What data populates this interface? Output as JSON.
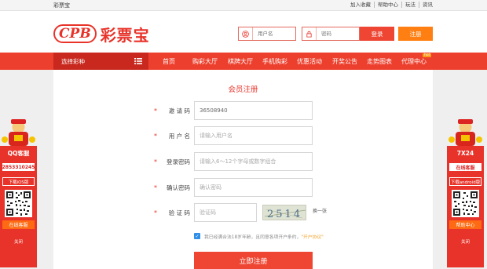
{
  "topbar": {
    "site_name": "彩票宝",
    "links": [
      "加入收藏",
      "帮助中心",
      "玩法",
      "资讯"
    ]
  },
  "logo": {
    "mark": "CPB",
    "name": "彩票宝"
  },
  "login": {
    "username_placeholder": "用户名",
    "password_placeholder": "密码",
    "login_button": "登录",
    "register_button": "注册"
  },
  "nav": {
    "select_lottery": "选择彩种",
    "items": [
      "首页",
      "购彩大厅",
      "棋牌大厅",
      "手机购彩",
      "优惠活动",
      "开奖公告",
      "走势图表",
      "代理中心"
    ],
    "hot_badge": "hot"
  },
  "form": {
    "title": "会员注册",
    "invite_label": "邀 请 码",
    "invite_value": "36508940",
    "username_label": "用 户 名",
    "username_placeholder": "请输入用户名",
    "password_label": "登录密码",
    "password_placeholder": "请输入6～12个字母或数字组合",
    "confirm_label": "确认密码",
    "confirm_placeholder": "确认密码",
    "captcha_label": "验 证 码",
    "captcha_placeholder": "验证码",
    "captcha_text": "2514",
    "refresh_label": "换一张",
    "agree_text": "我已经满合法18岁年龄，且同意各项开户条约，",
    "agree_link": "\"开户协议\"",
    "submit_label": "立即注册"
  },
  "left_side": {
    "brand": "QQ客服",
    "number": "2853310245",
    "download": "下载iOS版",
    "service": "在线客服",
    "close": "关闭"
  },
  "right_side": {
    "brand": "7X24",
    "service_top": "在线客服",
    "download": "下载android版",
    "service": "帮助中心",
    "close": "关闭"
  },
  "colors": {
    "brand_red": "#e8332a",
    "nav_red": "#ed3f2d",
    "orange": "#ff7f12",
    "checkbox_blue": "#2f8ee8"
  }
}
